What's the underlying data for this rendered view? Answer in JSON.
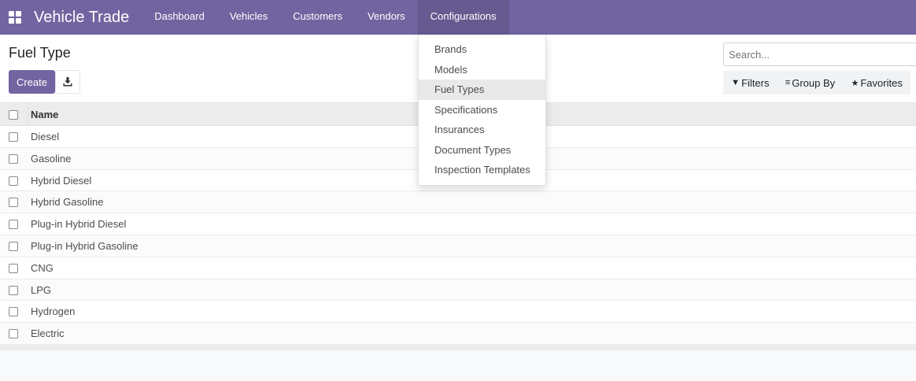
{
  "app": {
    "title": "Vehicle Trade"
  },
  "nav": {
    "items": [
      {
        "label": "Dashboard"
      },
      {
        "label": "Vehicles"
      },
      {
        "label": "Customers"
      },
      {
        "label": "Vendors"
      },
      {
        "label": "Configurations",
        "active": true
      }
    ]
  },
  "page": {
    "title": "Fuel Type"
  },
  "toolbar": {
    "create_label": "Create",
    "download_icon": "download-icon"
  },
  "search": {
    "placeholder": "Search..."
  },
  "filters": {
    "filters_label": "Filters",
    "groupby_label": "Group By",
    "favorites_label": "Favorites"
  },
  "list": {
    "header": {
      "name": "Name"
    },
    "rows": [
      "Diesel",
      "Gasoline",
      "Hybrid Diesel",
      "Hybrid Gasoline",
      "Plug-in Hybrid Diesel",
      "Plug-in Hybrid Gasoline",
      "CNG",
      "LPG",
      "Hydrogen",
      "Electric"
    ]
  },
  "dropdown": {
    "items": [
      {
        "label": "Brands"
      },
      {
        "label": "Models"
      },
      {
        "label": "Fuel Types",
        "highlighted": true
      },
      {
        "label": "Specifications"
      },
      {
        "label": "Insurances"
      },
      {
        "label": "Document Types"
      },
      {
        "label": "Inspection Templates"
      }
    ]
  },
  "colors": {
    "brand": "#7264a0",
    "nav_active": "#665a90"
  }
}
